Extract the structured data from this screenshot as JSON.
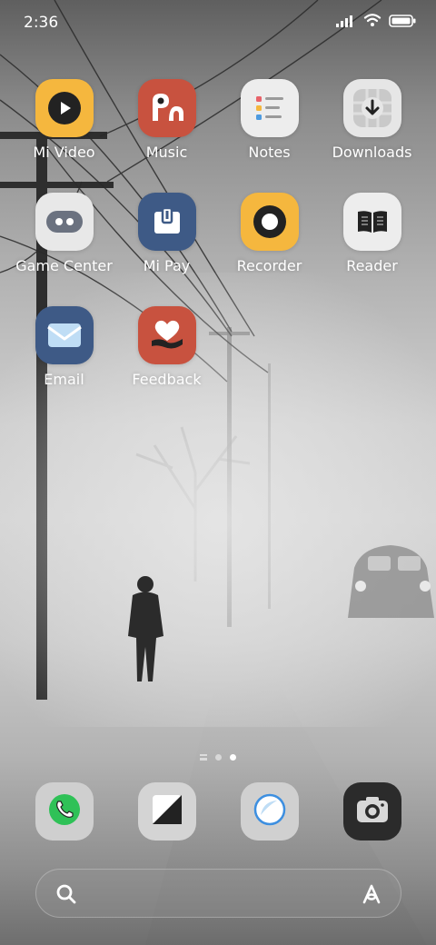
{
  "status_bar": {
    "time": "2:36"
  },
  "apps": [
    {
      "label": "Mi Video",
      "icon": "play-icon",
      "color": "#F5B73E"
    },
    {
      "label": "Music",
      "icon": "music-icon",
      "color": "#C8523F"
    },
    {
      "label": "Notes",
      "icon": "notes-icon",
      "color": "#EDEDED"
    },
    {
      "label": "Downloads",
      "icon": "download-icon",
      "color": "#E6E6E6"
    },
    {
      "label": "Game Center",
      "icon": "game-controller-icon",
      "color": "#E8E8E8"
    },
    {
      "label": "Mi Pay",
      "icon": "wallet-icon",
      "color": "#3E5A86"
    },
    {
      "label": "Recorder",
      "icon": "record-icon",
      "color": "#F5B73E"
    },
    {
      "label": "Reader",
      "icon": "book-icon",
      "color": "#EDEDED"
    },
    {
      "label": "Email",
      "icon": "envelope-icon",
      "color": "#3E5A86"
    },
    {
      "label": "Feedback",
      "icon": "heart-hand-icon",
      "color": "#C8523F"
    }
  ],
  "page_indicator": {
    "pages": 2,
    "active": 2
  },
  "dock": [
    {
      "name": "Phone",
      "icon": "phone-icon"
    },
    {
      "name": "Messages",
      "icon": "messages-icon"
    },
    {
      "name": "Browser",
      "icon": "browser-icon"
    },
    {
      "name": "Camera",
      "icon": "camera-icon"
    }
  ],
  "search": {
    "icon": "search-icon",
    "assistant_icon": "assistant-icon"
  }
}
